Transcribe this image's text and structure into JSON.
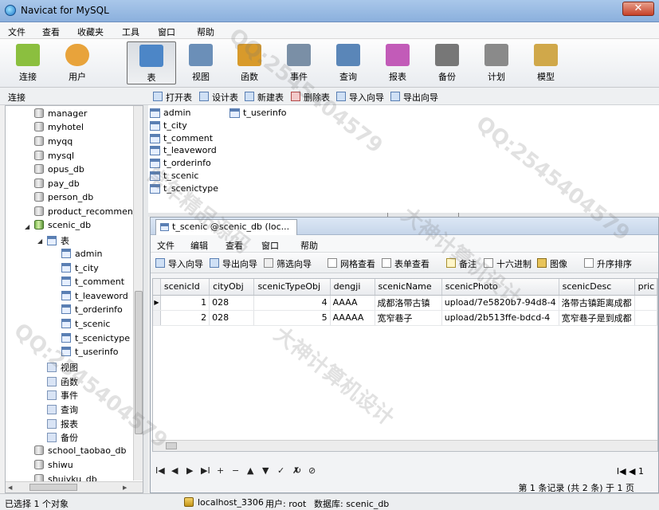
{
  "window": {
    "title": "Navicat for MySQL",
    "close_glyph": "✕"
  },
  "menu": [
    "文件",
    "查看",
    "收藏夹",
    "工具",
    "窗口",
    "帮助"
  ],
  "toolbar": [
    {
      "label": "连接",
      "icon": "connection-icon",
      "color": "#8bbf3f"
    },
    {
      "label": "用户",
      "icon": "user-icon",
      "color": "#e8a33b"
    },
    {
      "label": "表",
      "icon": "table-icon",
      "color": "#4c86c7"
    },
    {
      "label": "视图",
      "icon": "view-icon",
      "color": "#6b8fb8"
    },
    {
      "label": "函数",
      "icon": "function-icon",
      "color": "#d89a2b"
    },
    {
      "label": "事件",
      "icon": "event-icon",
      "color": "#7a8fa6"
    },
    {
      "label": "查询",
      "icon": "query-icon",
      "color": "#5a86b8"
    },
    {
      "label": "报表",
      "icon": "report-icon",
      "color": "#c25bb8"
    },
    {
      "label": "备份",
      "icon": "backup-icon",
      "color": "#777777"
    },
    {
      "label": "计划",
      "icon": "schedule-icon",
      "color": "#8a8a8a"
    },
    {
      "label": "模型",
      "icon": "model-icon",
      "color": "#d0a84a"
    }
  ],
  "connbar": {
    "label": "连接",
    "actions": [
      "打开表",
      "设计表",
      "新建表",
      "删除表",
      "导入向导",
      "导出向导"
    ]
  },
  "tree": {
    "databases_before": [
      "manager",
      "myhotel",
      "myqq",
      "mysql",
      "opus_db",
      "pay_db",
      "person_db",
      "product_recommend"
    ],
    "open_db": "scenic_db",
    "tables_group": "表",
    "tables": [
      "admin",
      "t_city",
      "t_comment",
      "t_leaveword",
      "t_orderinfo",
      "t_scenic",
      "t_scenictype",
      "t_userinfo"
    ],
    "groups": [
      "视图",
      "函数",
      "事件",
      "查询",
      "报表",
      "备份"
    ],
    "databases_after": [
      "school_taobao_db",
      "shiwu",
      "shuiyku_db"
    ]
  },
  "objects": [
    "admin",
    "t_city",
    "t_comment",
    "t_leaveword",
    "t_orderinfo",
    "t_scenic",
    "t_scenictype",
    "t_userinfo"
  ],
  "inner": {
    "tab": "t_scenic @scenic_db (loc...",
    "menu": [
      "文件",
      "编辑",
      "查看",
      "窗口",
      "帮助"
    ],
    "tools": [
      "导入向导",
      "导出向导",
      "筛选向导",
      "网格查看",
      "表单查看",
      "备注",
      "十六进制",
      "图像",
      "升序排序"
    ]
  },
  "grid": {
    "columns": [
      "scenicId",
      "cityObj",
      "scenicTypeObj",
      "dengji",
      "scenicName",
      "scenicPhoto",
      "scenicDesc",
      "pric"
    ],
    "rows": [
      [
        "1",
        "028",
        "4",
        "AAAA",
        "成都洛带古镇",
        "upload/7e5820b7-94d8-4",
        "洛带古镇距离成都"
      ],
      [
        "2",
        "028",
        "5",
        "AAAAA",
        "宽窄巷子",
        "upload/2b513ffe-bdcd-4",
        "宽窄巷子是到成都"
      ]
    ]
  },
  "nav": [
    "I◀",
    "◀",
    "▶",
    "▶I",
    "+",
    "−",
    "▲",
    "▼",
    "✓",
    "✗",
    "↻",
    "⊘"
  ],
  "pager": "1",
  "records": "第 1 条记录 (共 2 条) 于 1 页",
  "status": {
    "left": "已选择 1 个对象",
    "host": "localhost_3306",
    "user": "用户: root",
    "db": "数据库: scenic_db"
  },
  "watermarks": [
    "QQ:2545404579",
    "大神计算机设计",
    "常年精品源码",
    "QQ:2545404579",
    "大神计算机设计",
    "QQ:2545404579"
  ]
}
